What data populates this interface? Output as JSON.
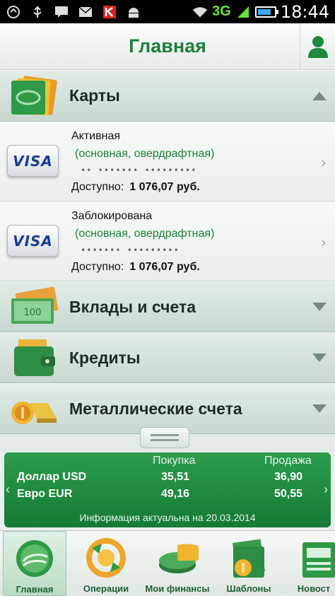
{
  "statusbar": {
    "network": "3G",
    "time": "18:44"
  },
  "header": {
    "title": "Главная"
  },
  "sections": {
    "cards": {
      "title": "Карты"
    },
    "deposits": {
      "title": "Вклады и счета"
    },
    "credits": {
      "title": "Кредиты"
    },
    "metals": {
      "title": "Металлические счета"
    }
  },
  "cards": [
    {
      "brand": "VISA",
      "status": "Активная",
      "type": "(основная, овердрафтная)",
      "number": "•• ••••••• •••••••••",
      "available_label": "Доступно:",
      "available_value": "1 076,07 руб."
    },
    {
      "brand": "VISA",
      "status": "Заблокирована",
      "type": "(основная, овердрафтная)",
      "number": "••••••• •••••••••",
      "available_label": "Доступно:",
      "available_value": "1 076,07 руб."
    }
  ],
  "currency": {
    "buy_header": "Покупка",
    "sell_header": "Продажа",
    "rows": [
      {
        "name": "Доллар USD",
        "buy": "35,51",
        "sell": "36,90"
      },
      {
        "name": "Евро EUR",
        "buy": "49,16",
        "sell": "50,55"
      }
    ],
    "info": "Информация актуальна на 20.03.2014"
  },
  "bottom_nav": [
    {
      "label": "Главная"
    },
    {
      "label": "Операции"
    },
    {
      "label": "Мои финансы"
    },
    {
      "label": "Шаблоны"
    },
    {
      "label": "Новост"
    }
  ],
  "colors": {
    "brand_green": "#1d7f3a",
    "panel_green": "#1f8b41"
  }
}
